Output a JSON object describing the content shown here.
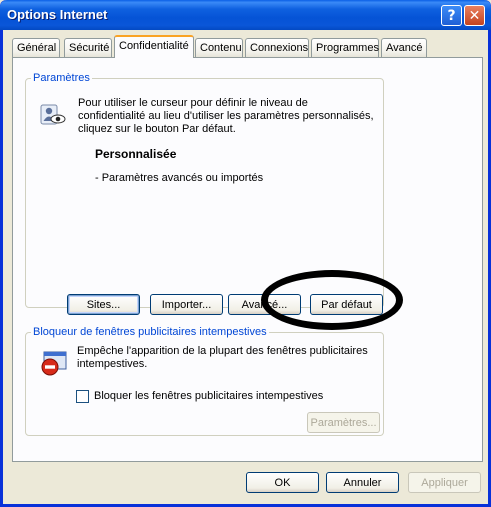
{
  "window": {
    "title": "Options Internet",
    "help_glyph": "?",
    "close_glyph": "✕"
  },
  "tabs": [
    {
      "label": "Général"
    },
    {
      "label": "Sécurité"
    },
    {
      "label": "Confidentialité"
    },
    {
      "label": "Contenu"
    },
    {
      "label": "Connexions"
    },
    {
      "label": "Programmes"
    },
    {
      "label": "Avancé"
    }
  ],
  "active_tab": "Confidentialité",
  "params": {
    "legend": "Paramètres",
    "description": "Pour utiliser le curseur pour définir le niveau de confidentialité au lieu d'utiliser les paramètres personnalisés, cliquez sur le bouton Par défaut.",
    "level_title": "Personnalisée",
    "level_detail": "- Paramètres avancés ou importés",
    "buttons": {
      "sites": "Sites...",
      "import": "Importer...",
      "advanced": "Avancé...",
      "default": "Par défaut"
    }
  },
  "popup": {
    "legend": "Bloqueur de fenêtres publicitaires intempestives",
    "description": "Empêche l'apparition de la plupart des fenêtres publicitaires intempestives.",
    "checkbox_label": "Bloquer les fenêtres publicitaires intempestives",
    "checkbox_checked": false,
    "settings_button": "Paramètres..."
  },
  "footer": {
    "ok": "OK",
    "cancel": "Annuler",
    "apply": "Appliquer"
  },
  "icons": {
    "privacy": "privacy-person-eye-icon",
    "popup_block": "popup-blocker-icon"
  }
}
